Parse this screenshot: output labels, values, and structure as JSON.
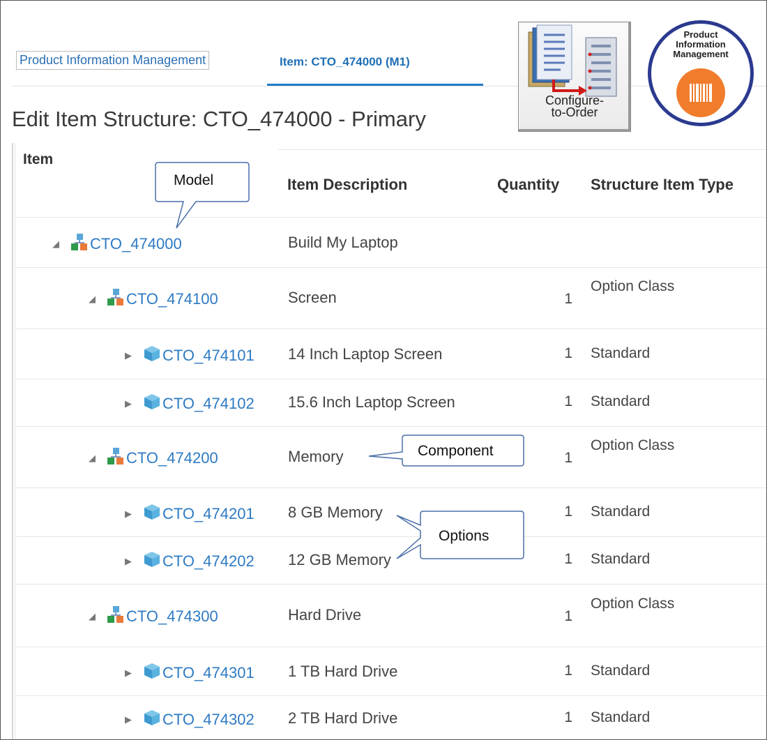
{
  "tabs": {
    "first": "Product Information Management",
    "active": "Item: CTO_474000 (M1)"
  },
  "page_title": "Edit Item Structure: CTO_474000 - Primary",
  "app_icons": {
    "cto_label_line1": "Configure-",
    "cto_label_line2": "to-Order",
    "pim_line1": "Product",
    "pim_line2": "Information",
    "pim_line3": "Management"
  },
  "columns": {
    "item": "Item",
    "description": "Item Description",
    "quantity": "Quantity",
    "structure_type": "Structure Item Type"
  },
  "rows": [
    {
      "item": "CTO_474000",
      "desc": "Build My Laptop",
      "qty": "",
      "type": "",
      "level": 0,
      "kind": "model",
      "expanded": true
    },
    {
      "item": "CTO_474100",
      "desc": "Screen",
      "qty": "1",
      "type": "Option Class",
      "level": 1,
      "kind": "model",
      "expanded": true
    },
    {
      "item": "CTO_474101",
      "desc": "14 Inch Laptop Screen",
      "qty": "1",
      "type": "Standard",
      "level": 2,
      "kind": "standard",
      "expanded": false
    },
    {
      "item": "CTO_474102",
      "desc": "15.6 Inch Laptop Screen",
      "qty": "1",
      "type": "Standard",
      "level": 2,
      "kind": "standard",
      "expanded": false
    },
    {
      "item": "CTO_474200",
      "desc": "Memory",
      "qty": "1",
      "type": "Option Class",
      "level": 1,
      "kind": "model",
      "expanded": true
    },
    {
      "item": "CTO_474201",
      "desc": "8 GB Memory",
      "qty": "1",
      "type": "Standard",
      "level": 2,
      "kind": "standard",
      "expanded": false
    },
    {
      "item": "CTO_474202",
      "desc": "12 GB Memory",
      "qty": "1",
      "type": "Standard",
      "level": 2,
      "kind": "standard",
      "expanded": false
    },
    {
      "item": "CTO_474300",
      "desc": "Hard Drive",
      "qty": "1",
      "type": "Option Class",
      "level": 1,
      "kind": "model",
      "expanded": true
    },
    {
      "item": "CTO_474301",
      "desc": "1 TB Hard Drive",
      "qty": "1",
      "type": "Standard",
      "level": 2,
      "kind": "standard",
      "expanded": false
    },
    {
      "item": "CTO_474302",
      "desc": "2 TB Hard Drive",
      "qty": "1",
      "type": "Standard",
      "level": 2,
      "kind": "standard",
      "expanded": false
    }
  ],
  "callouts": {
    "model": "Model",
    "component": "Component",
    "options": "Options"
  },
  "colors": {
    "link": "#2d7ac3",
    "tab_underline": "#1f7ac8",
    "pim_ring": "#2b3a8f",
    "pim_orange": "#f07c2c"
  }
}
